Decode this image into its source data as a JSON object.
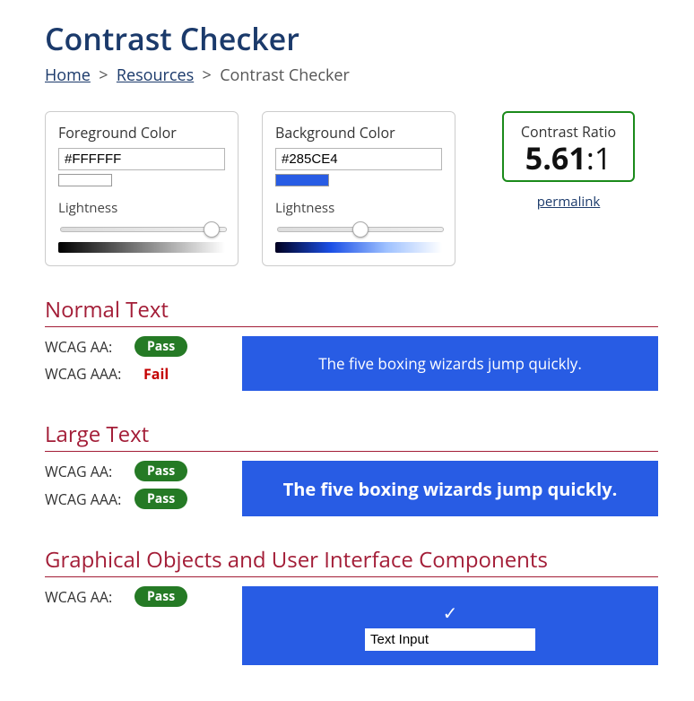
{
  "title": "Contrast Checker",
  "breadcrumb": {
    "home": "Home",
    "resources": "Resources",
    "current": "Contrast Checker"
  },
  "fg": {
    "legend": "Foreground Color",
    "value": "#FFFFFF",
    "lightness_label": "Lightness",
    "lightness": 96
  },
  "bg": {
    "legend": "Background Color",
    "value": "#285CE4",
    "lightness_label": "Lightness",
    "lightness": 50
  },
  "ratio": {
    "label": "Contrast Ratio",
    "value": "5.61",
    "suffix": ":1",
    "permalink": "permalink"
  },
  "sections": {
    "normal": {
      "heading": "Normal Text",
      "aa_label": "WCAG AA:",
      "aa_result": "Pass",
      "aaa_label": "WCAG AAA:",
      "aaa_result": "Fail",
      "sample": "The five boxing wizards jump quickly."
    },
    "large": {
      "heading": "Large Text",
      "aa_label": "WCAG AA:",
      "aa_result": "Pass",
      "aaa_label": "WCAG AAA:",
      "aaa_result": "Pass",
      "sample": "The five boxing wizards jump quickly."
    },
    "ui": {
      "heading": "Graphical Objects and User Interface Components",
      "aa_label": "WCAG AA:",
      "aa_result": "Pass",
      "check": "✓",
      "input_value": "Text Input"
    }
  }
}
